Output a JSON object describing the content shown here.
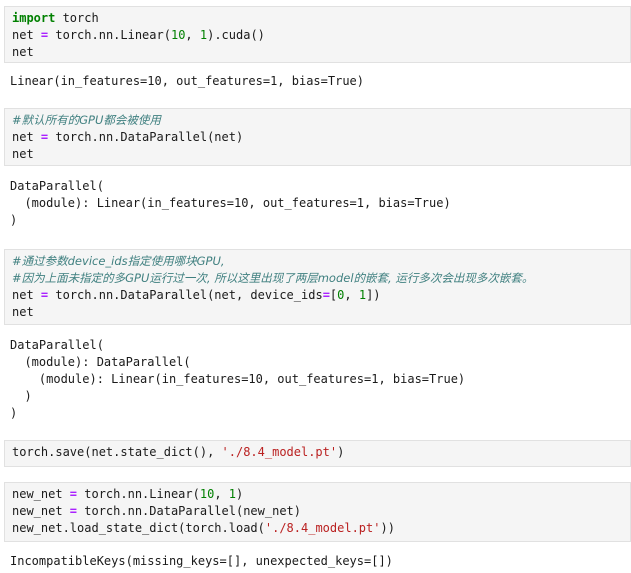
{
  "cells": [
    {
      "input": [
        [
          {
            "t": "import",
            "c": "kw"
          },
          {
            "t": " torch",
            "c": ""
          }
        ],
        [
          {
            "t": "net ",
            "c": ""
          },
          {
            "t": "=",
            "c": "op"
          },
          {
            "t": " torch.nn.Linear(",
            "c": ""
          },
          {
            "t": "10",
            "c": "num"
          },
          {
            "t": ", ",
            "c": ""
          },
          {
            "t": "1",
            "c": "num"
          },
          {
            "t": ").cuda()",
            "c": ""
          }
        ],
        [
          {
            "t": "net",
            "c": ""
          }
        ]
      ],
      "output": [
        "Linear(in_features=10, out_features=1, bias=True)"
      ]
    },
    {
      "input": [
        [
          {
            "t": "#默认所有的GPU都会被使用",
            "c": "cmt"
          }
        ],
        [
          {
            "t": "net ",
            "c": ""
          },
          {
            "t": "=",
            "c": "op"
          },
          {
            "t": " torch.nn.DataParallel(net)",
            "c": ""
          }
        ],
        [
          {
            "t": "net",
            "c": ""
          }
        ]
      ],
      "output": [
        "DataParallel(",
        "  (module): Linear(in_features=10, out_features=1, bias=True)",
        ")"
      ]
    },
    {
      "input": [
        [
          {
            "t": "#通过参数device_ids指定使用哪块GPU,",
            "c": "cmt"
          }
        ],
        [
          {
            "t": "#因为上面未指定的多GPU运行过一次, 所以这里出现了两层model的嵌套, 运行多次会出现多次嵌套。",
            "c": "cmt"
          }
        ],
        [
          {
            "t": "net ",
            "c": ""
          },
          {
            "t": "=",
            "c": "op"
          },
          {
            "t": " torch.nn.DataParallel(net, device_ids",
            "c": ""
          },
          {
            "t": "=",
            "c": "op"
          },
          {
            "t": "[",
            "c": ""
          },
          {
            "t": "0",
            "c": "num"
          },
          {
            "t": ", ",
            "c": ""
          },
          {
            "t": "1",
            "c": "num"
          },
          {
            "t": "])",
            "c": ""
          }
        ],
        [
          {
            "t": "net",
            "c": ""
          }
        ]
      ],
      "output": [
        "DataParallel(",
        "  (module): DataParallel(",
        "    (module): Linear(in_features=10, out_features=1, bias=True)",
        "  )",
        ")"
      ]
    },
    {
      "input": [
        [
          {
            "t": "torch.save(net.state_dict(), ",
            "c": ""
          },
          {
            "t": "'./8.4_model.pt'",
            "c": "str"
          },
          {
            "t": ")",
            "c": ""
          }
        ]
      ],
      "output": []
    },
    {
      "input": [
        [
          {
            "t": "new_net ",
            "c": ""
          },
          {
            "t": "=",
            "c": "op"
          },
          {
            "t": " torch.nn.Linear(",
            "c": ""
          },
          {
            "t": "10",
            "c": "num"
          },
          {
            "t": ", ",
            "c": ""
          },
          {
            "t": "1",
            "c": "num"
          },
          {
            "t": ")",
            "c": ""
          }
        ],
        [
          {
            "t": "new_net ",
            "c": ""
          },
          {
            "t": "=",
            "c": "op"
          },
          {
            "t": " torch.nn.DataParallel(new_net)",
            "c": ""
          }
        ],
        [
          {
            "t": "new_net.load_state_dict(torch.load(",
            "c": ""
          },
          {
            "t": "'./8.4_model.pt'",
            "c": "str"
          },
          {
            "t": "))",
            "c": ""
          }
        ]
      ],
      "output": [
        "IncompatibleKeys(missing_keys=[], unexpected_keys=[])"
      ]
    }
  ]
}
